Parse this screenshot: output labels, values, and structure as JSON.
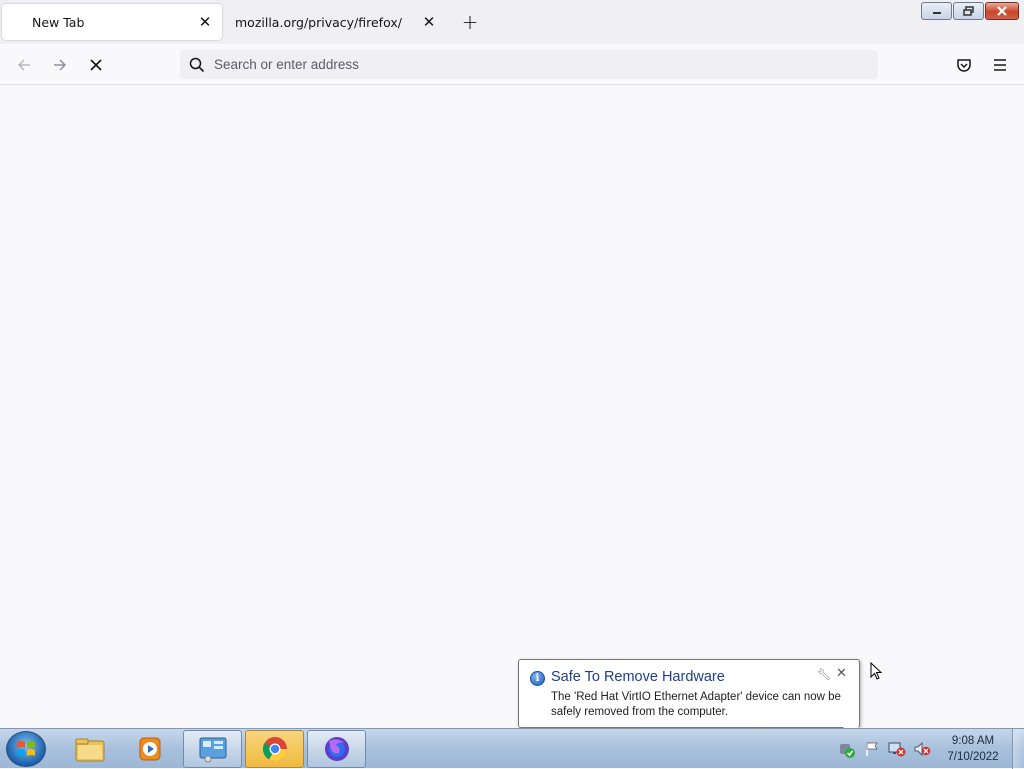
{
  "browser": {
    "tabs": [
      {
        "title": "New Tab",
        "active": true
      },
      {
        "title": "mozilla.org/privacy/firefox/",
        "active": false
      }
    ],
    "new_tab_label": "+",
    "address_bar": {
      "placeholder": "Search or enter address",
      "value": ""
    }
  },
  "notification": {
    "title": "Safe To Remove Hardware",
    "message": "The 'Red Hat VirtIO Ethernet Adapter' device can now be safely removed from the computer."
  },
  "taskbar": {
    "pinned": [
      {
        "name": "Windows Explorer",
        "icon": "folder-icon"
      },
      {
        "name": "Windows Media Player",
        "icon": "media-player-icon"
      },
      {
        "name": "Control Panel",
        "icon": "control-panel-icon"
      },
      {
        "name": "Google Chrome",
        "icon": "chrome-icon"
      },
      {
        "name": "Firefox",
        "icon": "firefox-icon"
      }
    ],
    "clock": {
      "time": "9:08 AM",
      "date": "7/10/2022"
    }
  },
  "colors": {
    "accent": "#0060df",
    "notification_title": "#1e3f8a",
    "taskbar": "#a8c0dc"
  }
}
